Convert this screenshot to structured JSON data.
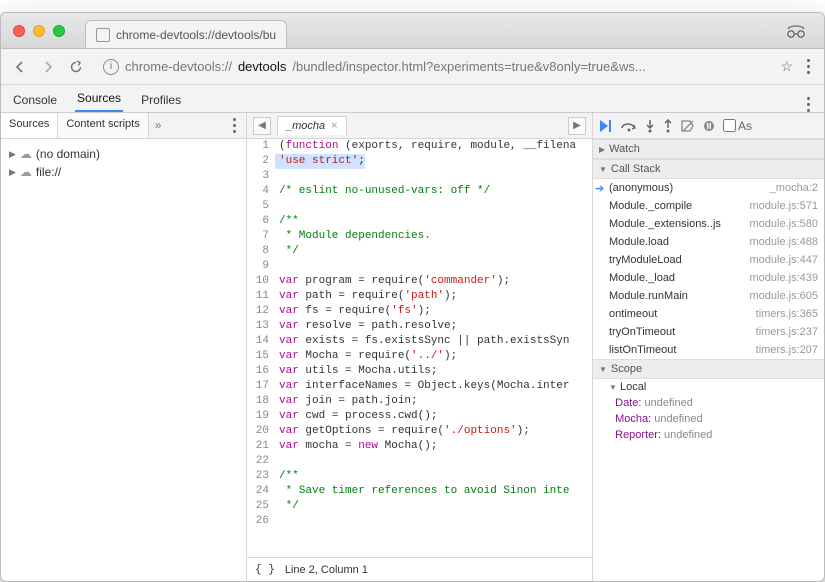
{
  "chrome": {
    "tab_title": "chrome-devtools://devtools/bu",
    "url_left": "chrome-devtools://",
    "url_bold": "devtools",
    "url_right": "/bundled/inspector.html?experiments=true&v8only=true&ws..."
  },
  "devtools_tabs": [
    "Console",
    "Sources",
    "Profiles"
  ],
  "devtools_tabs_active": 1,
  "sources": {
    "nav_tabs": [
      "Sources",
      "Content scripts"
    ],
    "nav_active": 0,
    "filetree": [
      "(no domain)",
      "file://"
    ],
    "open_file": "_mocha",
    "status": "Line 2, Column 1"
  },
  "code": [
    {
      "n": 1,
      "t": [
        "(",
        "function",
        " (exports, require, module, __filena"
      ],
      "cls": [
        "",
        "kw",
        ""
      ]
    },
    {
      "n": 2,
      "hl": true,
      "t": [
        "'use strict'",
        ";"
      ],
      "cls": [
        "str",
        ""
      ]
    },
    {
      "n": 3,
      "t": [
        ""
      ],
      "cls": [
        ""
      ]
    },
    {
      "n": 4,
      "t": [
        "/* eslint no-unused-vars: off */"
      ],
      "cls": [
        "cm"
      ]
    },
    {
      "n": 5,
      "t": [
        ""
      ],
      "cls": [
        ""
      ]
    },
    {
      "n": 6,
      "t": [
        "/**"
      ],
      "cls": [
        "cm"
      ]
    },
    {
      "n": 7,
      "t": [
        " * Module dependencies."
      ],
      "cls": [
        "cm"
      ]
    },
    {
      "n": 8,
      "t": [
        " */"
      ],
      "cls": [
        "cm"
      ]
    },
    {
      "n": 9,
      "t": [
        ""
      ],
      "cls": [
        ""
      ]
    },
    {
      "n": 10,
      "t": [
        "var",
        " program = require(",
        "'commander'",
        ");"
      ],
      "cls": [
        "kw",
        "",
        "str",
        ""
      ]
    },
    {
      "n": 11,
      "t": [
        "var",
        " path = require(",
        "'path'",
        ");"
      ],
      "cls": [
        "kw",
        "",
        "str",
        ""
      ]
    },
    {
      "n": 12,
      "t": [
        "var",
        " fs = require(",
        "'fs'",
        ");"
      ],
      "cls": [
        "kw",
        "",
        "str",
        ""
      ]
    },
    {
      "n": 13,
      "t": [
        "var",
        " resolve = path.resolve;"
      ],
      "cls": [
        "kw",
        ""
      ]
    },
    {
      "n": 14,
      "t": [
        "var",
        " exists = fs.existsSync || path.existsSyn"
      ],
      "cls": [
        "kw",
        ""
      ]
    },
    {
      "n": 15,
      "t": [
        "var",
        " Mocha = require(",
        "'../'",
        ");"
      ],
      "cls": [
        "kw",
        "",
        "str",
        ""
      ]
    },
    {
      "n": 16,
      "t": [
        "var",
        " utils = Mocha.utils;"
      ],
      "cls": [
        "kw",
        ""
      ]
    },
    {
      "n": 17,
      "t": [
        "var",
        " interfaceNames = Object.keys(Mocha.inter"
      ],
      "cls": [
        "kw",
        ""
      ]
    },
    {
      "n": 18,
      "t": [
        "var",
        " join = path.join;"
      ],
      "cls": [
        "kw",
        ""
      ]
    },
    {
      "n": 19,
      "t": [
        "var",
        " cwd = process.cwd();"
      ],
      "cls": [
        "kw",
        ""
      ]
    },
    {
      "n": 20,
      "t": [
        "var",
        " getOptions = require(",
        "'./options'",
        ");"
      ],
      "cls": [
        "kw",
        "",
        "str",
        ""
      ]
    },
    {
      "n": 21,
      "t": [
        "var",
        " mocha = ",
        "new",
        " Mocha();"
      ],
      "cls": [
        "kw",
        "",
        "kw",
        ""
      ]
    },
    {
      "n": 22,
      "t": [
        ""
      ],
      "cls": [
        ""
      ]
    },
    {
      "n": 23,
      "t": [
        "/**"
      ],
      "cls": [
        "cm"
      ]
    },
    {
      "n": 24,
      "t": [
        " * Save timer references to avoid Sinon inte"
      ],
      "cls": [
        "cm"
      ]
    },
    {
      "n": 25,
      "t": [
        " */"
      ],
      "cls": [
        "cm"
      ]
    },
    {
      "n": 26,
      "t": [
        ""
      ],
      "cls": [
        ""
      ]
    }
  ],
  "debugger": {
    "sections": {
      "watch": "Watch",
      "callstack": "Call Stack",
      "scope": "Scope",
      "local": "Local"
    },
    "async_label": "As",
    "callstack": [
      {
        "fn": "(anonymous)",
        "loc": "_mocha:2",
        "sel": true
      },
      {
        "fn": "Module._compile",
        "loc": "module.js:571"
      },
      {
        "fn": "Module._extensions..js",
        "loc": "module.js:580"
      },
      {
        "fn": "Module.load",
        "loc": "module.js:488"
      },
      {
        "fn": "tryModuleLoad",
        "loc": "module.js:447"
      },
      {
        "fn": "Module._load",
        "loc": "module.js:439"
      },
      {
        "fn": "Module.runMain",
        "loc": "module.js:605"
      },
      {
        "fn": "ontimeout",
        "loc": "timers.js:365"
      },
      {
        "fn": "tryOnTimeout",
        "loc": "timers.js:237"
      },
      {
        "fn": "listOnTimeout",
        "loc": "timers.js:207"
      }
    ],
    "scope_local": [
      {
        "k": "Date",
        "v": "undefined"
      },
      {
        "k": "Mocha",
        "v": "undefined"
      },
      {
        "k": "Reporter",
        "v": "undefined"
      }
    ]
  }
}
